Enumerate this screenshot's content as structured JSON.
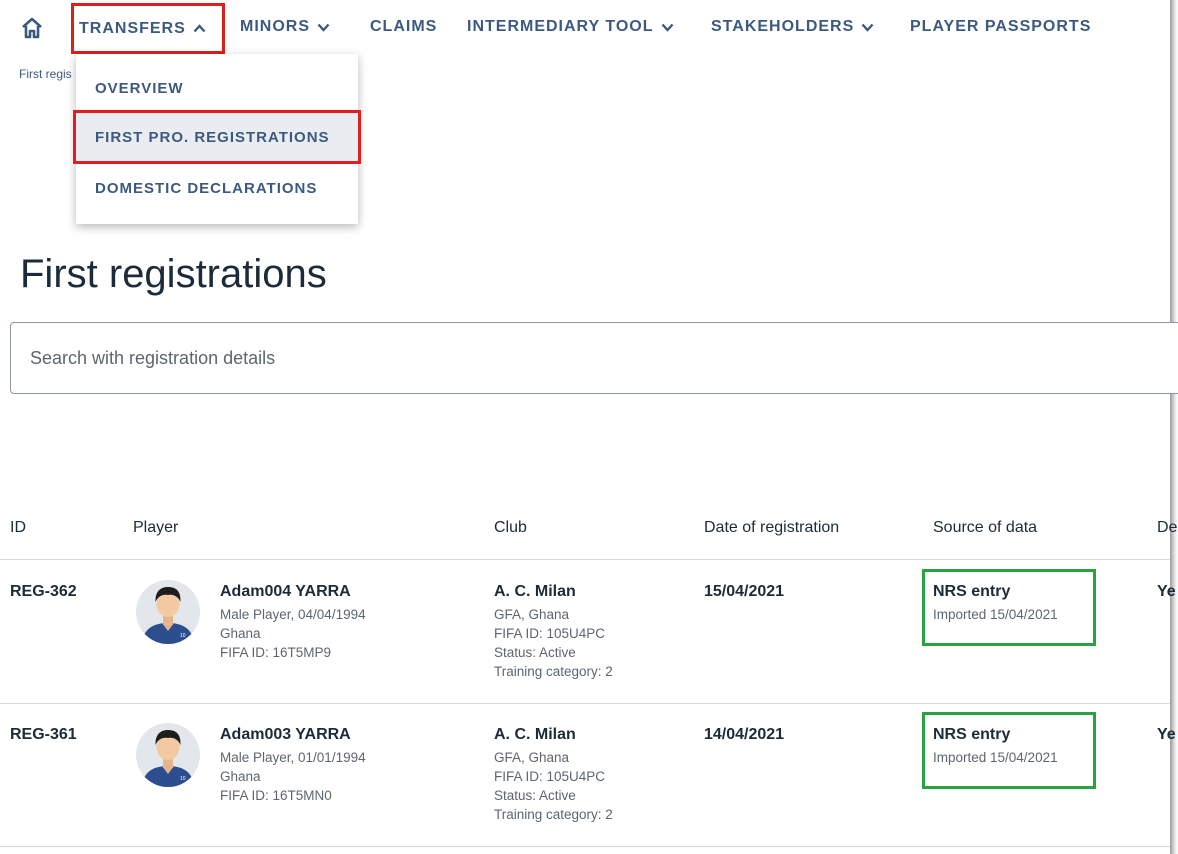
{
  "nav": {
    "items": [
      {
        "label": "TRANSFERS",
        "chevron": "up"
      },
      {
        "label": "MINORS",
        "chevron": "down"
      },
      {
        "label": "CLAIMS"
      },
      {
        "label": "INTERMEDIARY TOOL",
        "chevron": "down"
      },
      {
        "label": "STAKEHOLDERS",
        "chevron": "down"
      },
      {
        "label": "PLAYER PASSPORTS"
      }
    ],
    "home_icon": "home-icon"
  },
  "breadcrumb": "First regis",
  "dropdown": {
    "items": [
      {
        "label": "OVERVIEW"
      },
      {
        "label": "FIRST PRO. REGISTRATIONS"
      },
      {
        "label": "DOMESTIC DECLARATIONS"
      }
    ]
  },
  "page": {
    "title": "First registrations"
  },
  "search": {
    "placeholder": "Search with registration details",
    "value": ""
  },
  "table": {
    "headers": [
      "ID",
      "Player",
      "Club",
      "Date of registration",
      "Source of data",
      "De"
    ],
    "rows": [
      {
        "id": "REG-362",
        "player_name": "Adam004 YARRA",
        "player_line1": "Male Player, 04/04/1994",
        "player_line2": "Ghana",
        "player_line3": "FIFA ID: 16T5MP9",
        "club_name": "A. C. Milan",
        "club_line1": "GFA, Ghana",
        "club_line2": "FIFA ID: 105U4PC",
        "club_line3": "Status: Active",
        "club_line4": "Training category: 2",
        "date": "15/04/2021",
        "source_title": "NRS entry",
        "source_sub": "Imported 15/04/2021",
        "extra": "Ye"
      },
      {
        "id": "REG-361",
        "player_name": "Adam003 YARRA",
        "player_line1": "Male Player, 01/01/1994",
        "player_line2": "Ghana",
        "player_line3": "FIFA ID: 16T5MN0",
        "club_name": "A. C. Milan",
        "club_line1": "GFA, Ghana",
        "club_line2": "FIFA ID: 105U4PC",
        "club_line3": "Status: Active",
        "club_line4": "Training category: 2",
        "date": "14/04/2021",
        "source_title": "NRS entry",
        "source_sub": "Imported 15/04/2021",
        "extra": "Ye"
      }
    ]
  },
  "colors": {
    "nav_text": "#3c5a80",
    "highlight_red": "#e01e1e",
    "highlight_green": "#27a33f",
    "selected_bg": "#e9edf2"
  }
}
